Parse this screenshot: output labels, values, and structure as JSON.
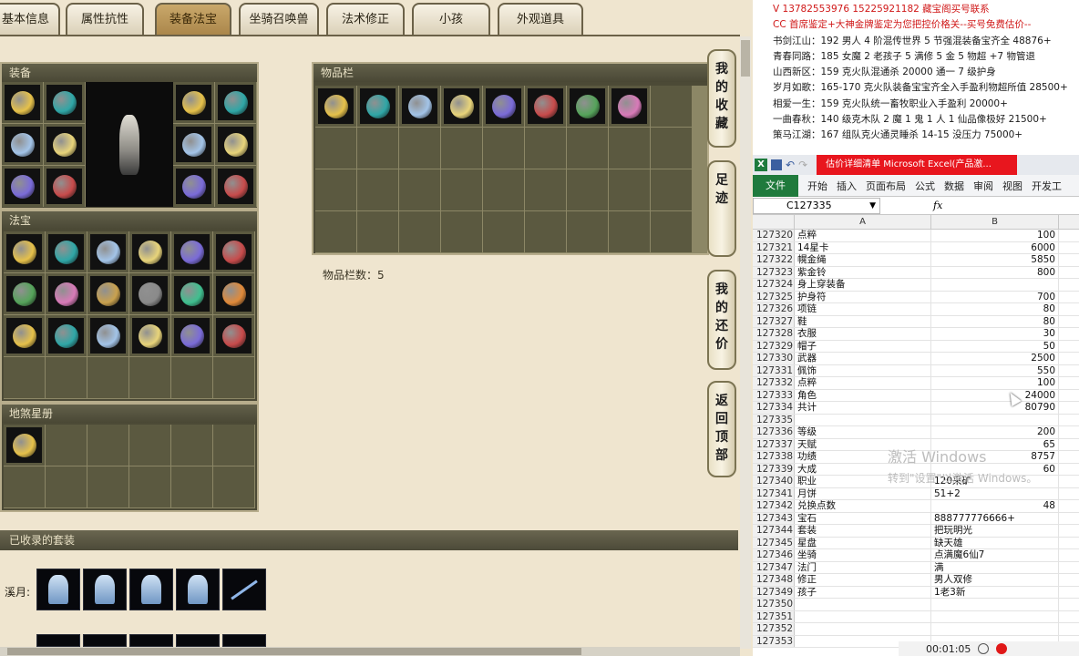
{
  "tabs": [
    {
      "label": "基本信息",
      "active": false
    },
    {
      "label": "属性抗性",
      "active": false
    },
    {
      "label": "装备法宝",
      "active": true
    },
    {
      "label": "坐骑召唤兽",
      "active": false
    },
    {
      "label": "法术修正",
      "active": false
    },
    {
      "label": "小孩",
      "active": false
    },
    {
      "label": "外观道具",
      "active": false
    }
  ],
  "equipment": {
    "title": "装备"
  },
  "treasure": {
    "title": "法宝"
  },
  "constellation": {
    "title": "地煞星册"
  },
  "inventory": {
    "title": "物品栏",
    "count_label": "物品栏数：5"
  },
  "side_buttons": [
    {
      "label": [
        "我",
        "的",
        "收",
        "藏"
      ]
    },
    {
      "label": [
        "足",
        "迹"
      ]
    },
    {
      "label": [
        "我",
        "的",
        "还",
        "价"
      ]
    },
    {
      "label": [
        "返",
        "回",
        "顶",
        "部"
      ]
    }
  ],
  "suits": {
    "title": "已收录的套装",
    "row_label": "溪月:"
  },
  "chat": [
    {
      "text": "V 13782553976    15225921182   藏宝阁买号联系",
      "red": true
    },
    {
      "text": "CC 首席鉴定+大神金牌鉴定为您把控价格关--买号免费估价--",
      "red": true
    },
    {
      "text": "书剑江山：192 男人 4 阶混传世界 5 节强混装备宝齐全 48876+",
      "red": false
    },
    {
      "text": "青春同路：185 女魔 2 老孩子 5 满修 5 金 5 物超 +7 物管退",
      "red": false
    },
    {
      "text": "山西新区：159 克火队混通杀 20000 通一 7 级护身",
      "red": false
    },
    {
      "text": "岁月如歌：165-170 克火队装备宝宝齐全入手盈利物超所值 28500+",
      "red": false
    },
    {
      "text": "相爱一生：159 克火队统一畜牧职业入手盈利 20000+",
      "red": false
    },
    {
      "text": "一曲春秋：140 级克木队 2 魔 1 鬼 1 人 1 仙品像极好 21500+",
      "red": false
    },
    {
      "text": "策马江湖：167 组队克火通灵睡杀 14-15 没压力 75000+",
      "red": false
    }
  ],
  "excel": {
    "red_title": "估价详细清单   Microsoft Excel(产品激...",
    "ribbon": [
      "开始",
      "插入",
      "页面布局",
      "公式",
      "数据",
      "审阅",
      "视图",
      "开发工"
    ],
    "file_tab": "文件",
    "name_box": "C127335",
    "fx": "fx",
    "col_a": "A",
    "col_b": "B",
    "rows": [
      {
        "n": "127320",
        "a": "点粹",
        "b": "100"
      },
      {
        "n": "127321",
        "a": "14星卡",
        "b": "6000"
      },
      {
        "n": "127322",
        "a": "幌金绳",
        "b": "5850"
      },
      {
        "n": "127323",
        "a": "紫金铃",
        "b": "800"
      },
      {
        "n": "127324",
        "a": "身上穿装备",
        "b": ""
      },
      {
        "n": "127325",
        "a": "护身符",
        "b": "700"
      },
      {
        "n": "127326",
        "a": "项链",
        "b": "80"
      },
      {
        "n": "127327",
        "a": "鞋",
        "b": "80"
      },
      {
        "n": "127328",
        "a": "衣服",
        "b": "30"
      },
      {
        "n": "127329",
        "a": "帽子",
        "b": "50"
      },
      {
        "n": "127330",
        "a": "武器",
        "b": "2500"
      },
      {
        "n": "127331",
        "a": "佩饰",
        "b": "550"
      },
      {
        "n": "127332",
        "a": "点粹",
        "b": "100"
      },
      {
        "n": "127333",
        "a": "角色",
        "b": "24000"
      },
      {
        "n": "127334",
        "a": "共计",
        "b": "80790"
      },
      {
        "n": "127335",
        "a": "",
        "b": ""
      },
      {
        "n": "127336",
        "a": "等级",
        "b": "200"
      },
      {
        "n": "127337",
        "a": "天赋",
        "b": "65"
      },
      {
        "n": "127338",
        "a": "功绩",
        "b": "8757"
      },
      {
        "n": "127339",
        "a": "大成",
        "b": "60"
      },
      {
        "n": "127340",
        "a": "职业",
        "b": "120采矿",
        "left": true
      },
      {
        "n": "127341",
        "a": "月饼",
        "b": "51+2",
        "left": true
      },
      {
        "n": "127342",
        "a": "兑换点数",
        "b": "48"
      },
      {
        "n": "127343",
        "a": "宝石",
        "b": "888777776666+",
        "left": true
      },
      {
        "n": "127344",
        "a": "套装",
        "b": "把玩明光",
        "left": true
      },
      {
        "n": "127345",
        "a": "星盘",
        "b": "缺天雄",
        "left": true
      },
      {
        "n": "127346",
        "a": "坐骑",
        "b": "点满魔6仙7",
        "left": true
      },
      {
        "n": "127347",
        "a": "法门",
        "b": "满",
        "left": true
      },
      {
        "n": "127348",
        "a": "修正",
        "b": "男人双修",
        "left": true
      },
      {
        "n": "127349",
        "a": "孩子",
        "b": "1老3新",
        "left": true
      },
      {
        "n": "127350",
        "a": "",
        "b": ""
      },
      {
        "n": "127351",
        "a": "",
        "b": ""
      },
      {
        "n": "127352",
        "a": "",
        "b": ""
      },
      {
        "n": "127353",
        "a": "",
        "b": ""
      }
    ]
  },
  "watermark": {
    "line1": "激活 Windows",
    "line2": "转到\"设置\"以激活 Windows。"
  },
  "recorder": {
    "time": "00:01:05"
  },
  "colors": {
    "accent_tab": "#b08c4e",
    "excel_green": "#1f7a3c",
    "excel_red": "#e8161e"
  }
}
